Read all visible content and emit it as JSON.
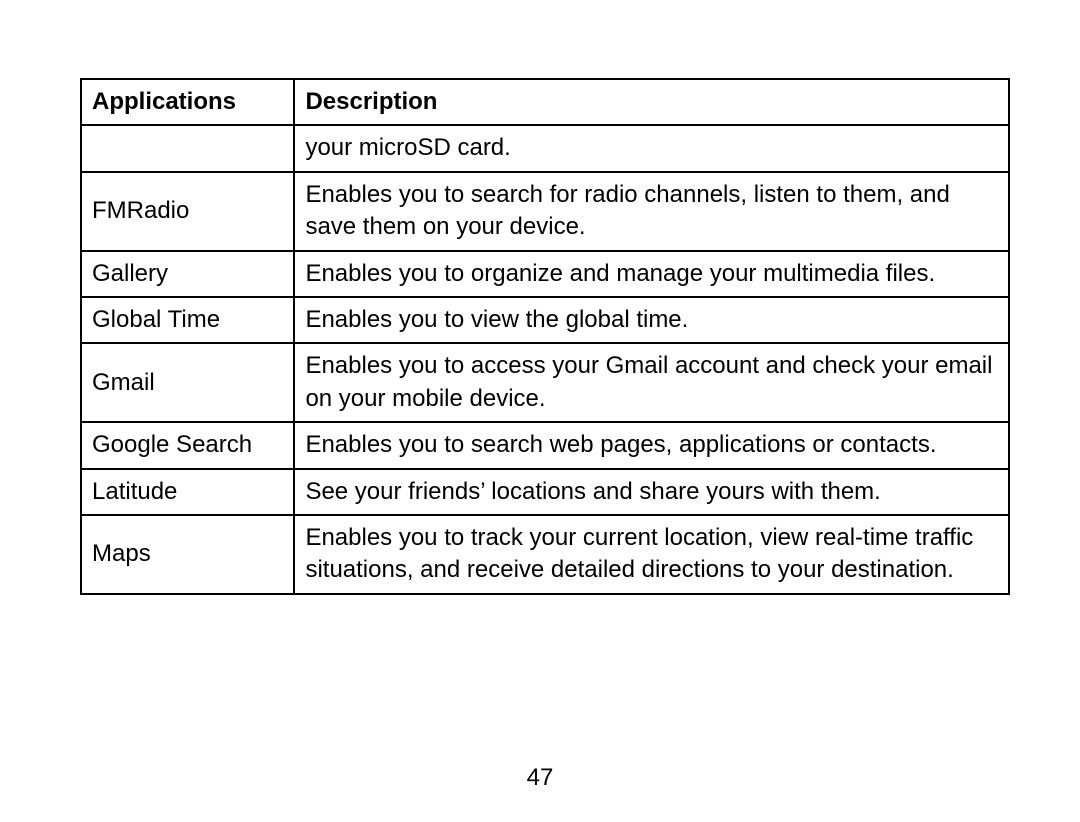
{
  "table": {
    "headers": {
      "applications": "Applications",
      "description": "Description"
    },
    "rows": [
      {
        "app": "",
        "desc": "your microSD card."
      },
      {
        "app": "FMRadio",
        "desc": "Enables you to search for radio channels, listen to them, and save them on your device."
      },
      {
        "app": "Gallery",
        "desc": "Enables you to organize and manage your multimedia files."
      },
      {
        "app": "Global Time",
        "desc": "Enables you to view the global time."
      },
      {
        "app": "Gmail",
        "desc": "Enables you to access your Gmail account and check your email on your mobile device."
      },
      {
        "app": "Google Search",
        "desc": "Enables you to search web pages, applications or contacts."
      },
      {
        "app": "Latitude",
        "desc": "See your friends’ locations and share yours with them."
      },
      {
        "app": "Maps",
        "desc": "Enables you to track your current location, view real-time traffic situations, and receive detailed directions to your destination."
      }
    ]
  },
  "page_number": "47"
}
